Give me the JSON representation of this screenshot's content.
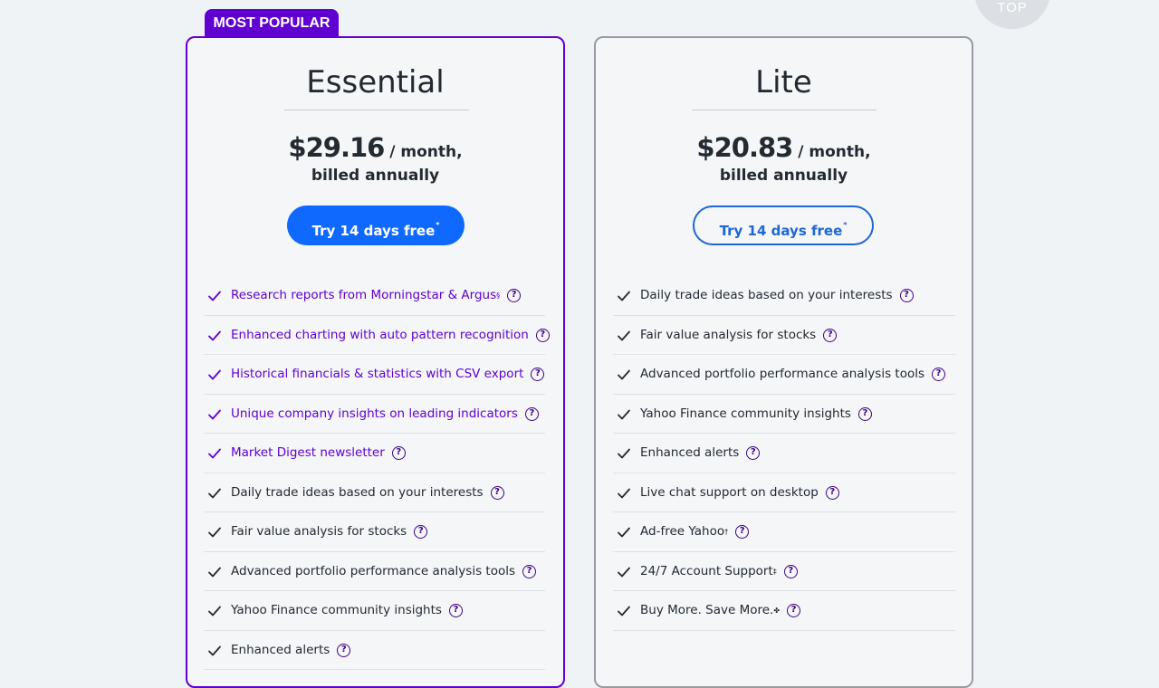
{
  "top_button": {
    "label": "TOP"
  },
  "badge": {
    "label": "MOST POPULAR"
  },
  "plans": {
    "essential": {
      "name": "Essential",
      "price": "$29.16",
      "period": " / month,",
      "billing": "billed annually",
      "cta_label": "Try 14 days free",
      "cta_mark": "*",
      "features": [
        {
          "text": "Research reports from Morningstar & Argus",
          "mark": "§",
          "highlight": true
        },
        {
          "text": "Enhanced charting with auto pattern recognition",
          "mark": "",
          "highlight": true
        },
        {
          "text": "Historical financials & statistics with CSV export",
          "mark": "",
          "highlight": true
        },
        {
          "text": "Unique company insights on leading indicators",
          "mark": "",
          "highlight": true
        },
        {
          "text": "Market Digest newsletter",
          "mark": "",
          "highlight": true
        },
        {
          "text": "Daily trade ideas based on your interests",
          "mark": "",
          "highlight": false
        },
        {
          "text": "Fair value analysis for stocks",
          "mark": "",
          "highlight": false
        },
        {
          "text": "Advanced portfolio performance analysis tools",
          "mark": "",
          "highlight": false
        },
        {
          "text": "Yahoo Finance community insights",
          "mark": "",
          "highlight": false
        },
        {
          "text": "Enhanced alerts",
          "mark": "",
          "highlight": false
        }
      ]
    },
    "lite": {
      "name": "Lite",
      "price": "$20.83",
      "period": " / month,",
      "billing": "billed annually",
      "cta_label": "Try 14 days free",
      "cta_mark": "*",
      "features": [
        {
          "text": "Daily trade ideas based on your interests",
          "mark": ""
        },
        {
          "text": "Fair value analysis for stocks",
          "mark": ""
        },
        {
          "text": "Advanced portfolio performance analysis tools",
          "mark": ""
        },
        {
          "text": "Yahoo Finance community insights",
          "mark": ""
        },
        {
          "text": "Enhanced alerts",
          "mark": ""
        },
        {
          "text": "Live chat support on desktop",
          "mark": ""
        },
        {
          "text": "Ad-free Yahoo",
          "mark": "†"
        },
        {
          "text": "24/7 Account Support",
          "mark": "‡"
        },
        {
          "text": "Buy More. Save More.",
          "mark": "✤"
        }
      ]
    }
  },
  "icons": {
    "check": "check-icon",
    "help": "help-circle-icon",
    "help_glyph": "?"
  },
  "colors": {
    "accent_purple": "#6001d2",
    "cta_blue": "#0f69ff",
    "outline_blue": "#1e67d4",
    "card_border_lite": "#979ba2"
  }
}
